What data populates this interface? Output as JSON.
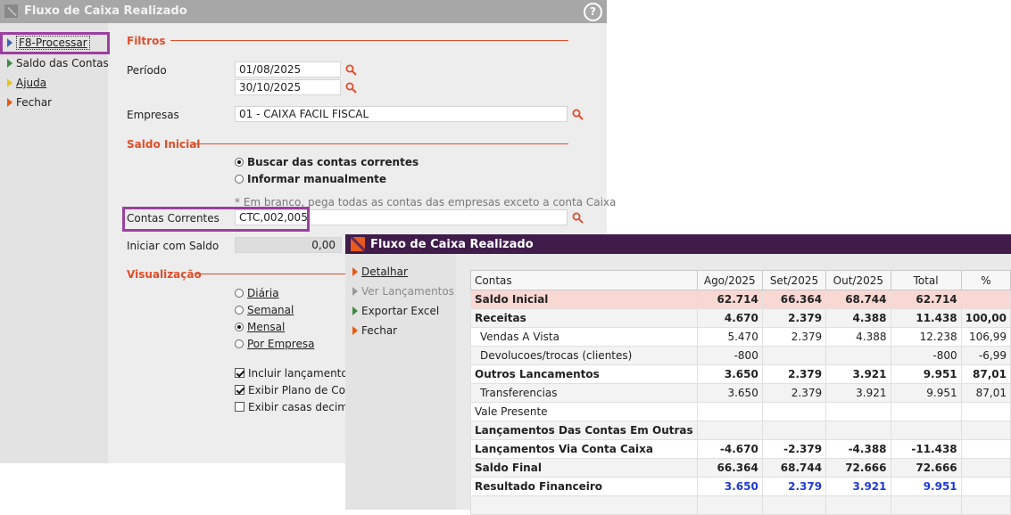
{
  "back_window": {
    "title": "Fluxo de Caixa Realizado",
    "help_icon": "?",
    "menu": [
      {
        "label": "F8-Processar",
        "icon": "triangle-blue-icon"
      },
      {
        "label": "Saldo das Contas",
        "icon": "triangle-green-icon"
      },
      {
        "label": "Ajuda",
        "icon": "triangle-yellow-icon"
      },
      {
        "label": "Fechar",
        "icon": "triangle-orange-icon"
      }
    ],
    "filtros": {
      "section_title": "Filtros",
      "periodo_label": "Período",
      "periodo_inicio": "01/08/2025",
      "periodo_fim": "30/10/2025",
      "empresas_label": "Empresas",
      "empresas_value": "01 - CAIXA  FACIL FISCAL"
    },
    "saldo_inicial": {
      "section_title": "Saldo Inicial",
      "option_buscar": "Buscar das contas correntes",
      "option_informar": "Informar manualmente",
      "note": "* Em branco, pega todas as contas das empresas exceto a conta Caixa",
      "contas_label": "Contas Correntes",
      "contas_value": "CTC,002,005",
      "iniciar_label": "Iniciar com Saldo",
      "iniciar_value": "0,00"
    },
    "visualizacao": {
      "section_title": "Visualização",
      "options": [
        "Diária",
        "Semanal",
        "Mensal",
        "Por Empresa"
      ],
      "selected": "Mensal",
      "checks": [
        {
          "label": "Incluir lançamentos f",
          "checked": true
        },
        {
          "label": "Exibir Plano de Conta",
          "checked": true
        },
        {
          "label": "Exibir casas decimais",
          "checked": false
        }
      ]
    }
  },
  "front_window": {
    "title": "Fluxo de Caixa Realizado",
    "menu": [
      {
        "label": "Detalhar",
        "icon": "triangle-orange-icon",
        "enabled": true
      },
      {
        "label": "Ver Lançamentos",
        "icon": "triangle-gray-icon",
        "enabled": false
      },
      {
        "label": "Exportar Excel",
        "icon": "triangle-green-icon",
        "enabled": true
      },
      {
        "label": "Fechar",
        "icon": "triangle-orange-icon",
        "enabled": true
      }
    ],
    "table": {
      "headers": [
        "Contas",
        "Ago/2025",
        "Set/2025",
        "Out/2025",
        "Total",
        "%"
      ],
      "rows": [
        {
          "name": "Saldo Inicial",
          "ago": "62.714",
          "set": "66.364",
          "out": "68.744",
          "total": "62.714",
          "pct": ""
        },
        {
          "name": "Receitas",
          "ago": "4.670",
          "set": "2.379",
          "out": "4.388",
          "total": "11.438",
          "pct": "100,00"
        },
        {
          "name": "Vendas A Vista",
          "ago": "5.470",
          "set": "2.379",
          "out": "4.388",
          "total": "12.238",
          "pct": "106,99"
        },
        {
          "name": "Devolucoes/trocas (clientes)",
          "ago": "-800",
          "set": "",
          "out": "",
          "total": "-800",
          "pct": "-6,99"
        },
        {
          "name": "Outros Lancamentos",
          "ago": "3.650",
          "set": "2.379",
          "out": "3.921",
          "total": "9.951",
          "pct": "87,01"
        },
        {
          "name": "Transferencias",
          "ago": "3.650",
          "set": "2.379",
          "out": "3.921",
          "total": "9.951",
          "pct": "87,01"
        },
        {
          "name": "Vale Presente",
          "ago": "",
          "set": "",
          "out": "",
          "total": "",
          "pct": ""
        },
        {
          "name": "Lançamentos Das Contas Em Outras",
          "ago": "",
          "set": "",
          "out": "",
          "total": "",
          "pct": ""
        },
        {
          "name": "Lançamentos Via Conta Caixa",
          "ago": "-4.670",
          "set": "-2.379",
          "out": "-4.388",
          "total": "-11.438",
          "pct": ""
        },
        {
          "name": "Saldo Final",
          "ago": "66.364",
          "set": "68.744",
          "out": "72.666",
          "total": "72.666",
          "pct": ""
        },
        {
          "name": "Resultado Financeiro",
          "ago": "3.650",
          "set": "2.379",
          "out": "3.921",
          "total": "9.951",
          "pct": ""
        }
      ]
    }
  },
  "colors": {
    "accent_orange": "#e04d2a",
    "highlight_purple": "#9b3fa0",
    "titlebar_purple": "#3f1c4a",
    "saldo_inicial_row": "#f9d8d4",
    "result_blue": "#1f3ad6"
  }
}
